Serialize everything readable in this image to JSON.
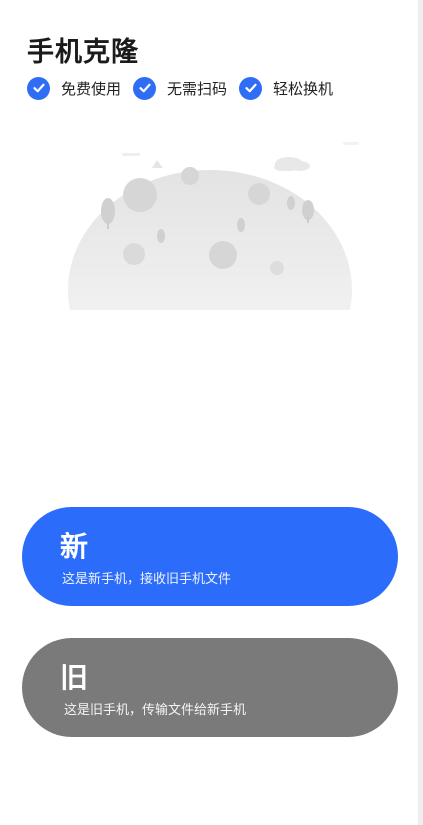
{
  "header": {
    "title": "手机克隆"
  },
  "features": [
    {
      "label": "免费使用",
      "icon": "check-circle-icon"
    },
    {
      "label": "无需扫码",
      "icon": "check-circle-icon"
    },
    {
      "label": "轻松换机",
      "icon": "check-circle-icon"
    }
  ],
  "options": {
    "new_phone": {
      "title": "新",
      "description": "这是新手机，接收旧手机文件"
    },
    "old_phone": {
      "title": "旧",
      "description": "这是旧手机，传输文件给新手机"
    }
  },
  "colors": {
    "accent": "#2c6cfb",
    "check": "#2f6df5",
    "old_button": "#7a7a7a",
    "background": "#ffffff"
  }
}
